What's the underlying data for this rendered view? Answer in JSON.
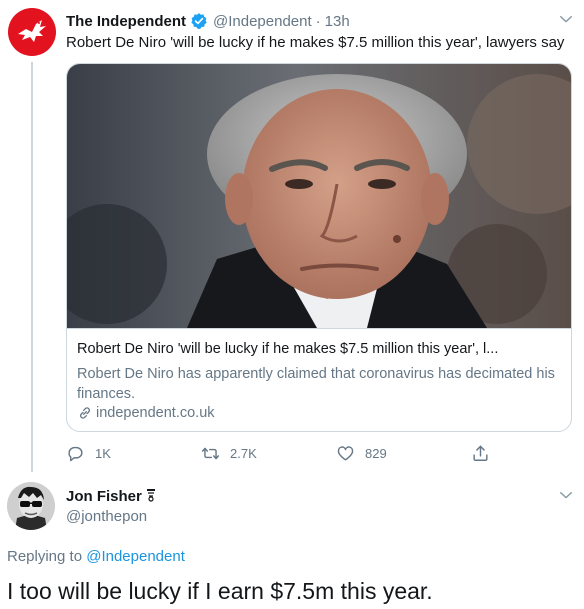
{
  "tweet": {
    "author_name": "The Independent",
    "author_handle": "@Independent",
    "separator": "·",
    "time": "13h",
    "text": "Robert De Niro 'will be lucky if he makes $7.5 million this year', lawyers say",
    "card": {
      "title": "Robert De Niro 'will be lucky if he makes $7.5 million this year', l...",
      "description": "Robert De Niro has apparently claimed that coronavirus has decimated his finances.",
      "domain": "independent.co.uk"
    },
    "actions": {
      "replies": "1K",
      "retweets": "2.7K",
      "likes": "829"
    }
  },
  "reply": {
    "author_name": "Jon Fisher",
    "author_handle": "@jonthepon",
    "replying_prefix": "Replying to ",
    "replying_to": "@Independent",
    "text": "I too will be lucky if I earn $7.5m this year."
  },
  "icons": {
    "verified": "verified-badge-icon",
    "chevron": "chevron-down-icon",
    "reply": "reply-icon",
    "retweet": "retweet-icon",
    "like": "heart-icon",
    "share": "share-icon",
    "link": "link-icon"
  },
  "colors": {
    "brand_red": "#e2121f",
    "link_blue": "#1b95e0",
    "verified_blue": "#1da1f2",
    "muted": "#657786"
  }
}
